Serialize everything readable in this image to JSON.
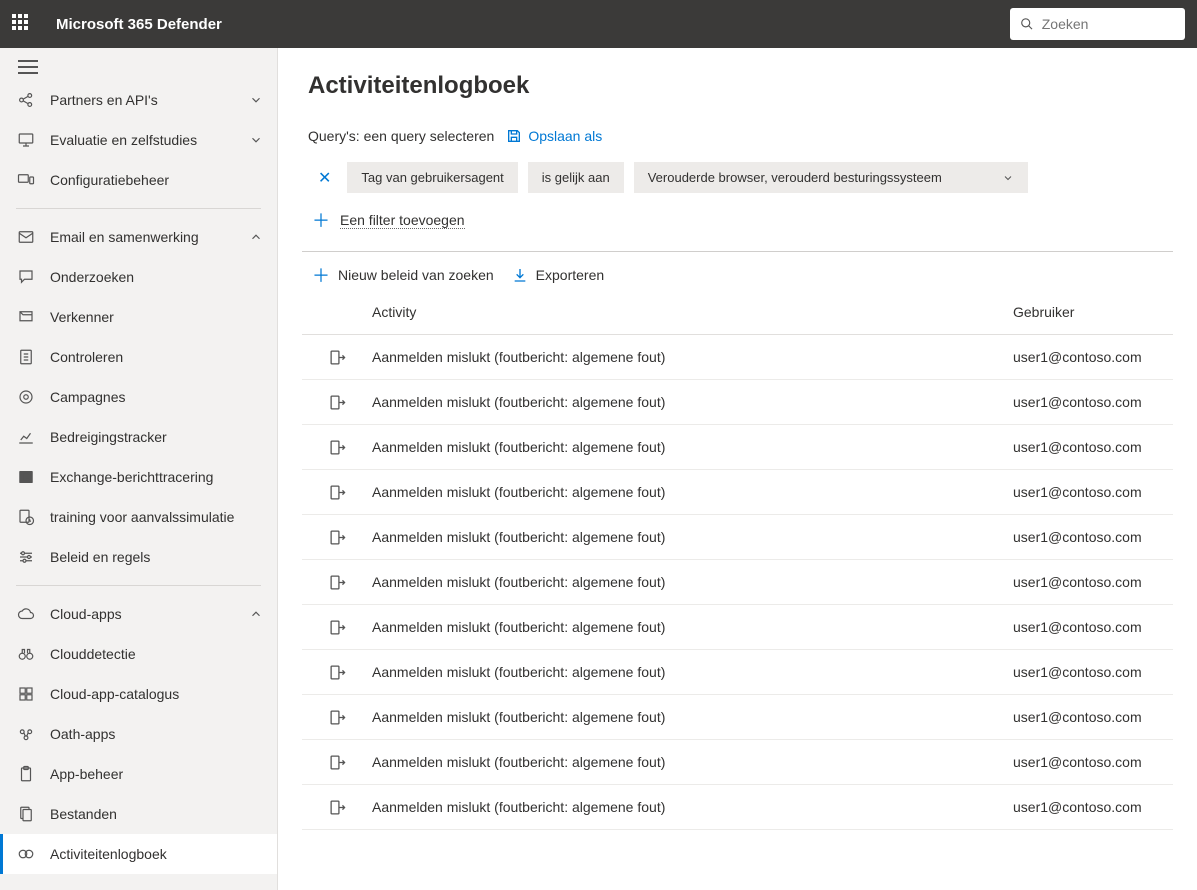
{
  "header": {
    "app_title": "Microsoft 365 Defender",
    "search_placeholder": "Zoeken"
  },
  "sidebar": {
    "groups": [
      {
        "label": "Partners en API's",
        "icon": "share-nodes",
        "chevron": "down"
      },
      {
        "label": "Evaluatie en zelfstudies",
        "icon": "monitor",
        "chevron": "down"
      },
      {
        "label": "Configuratiebeheer",
        "icon": "devices"
      }
    ],
    "email_section": {
      "label": "Email en samenwerking",
      "icon": "mail"
    },
    "email_items": [
      {
        "label": "Onderzoeken",
        "icon": "speech"
      },
      {
        "label": "Verkenner",
        "icon": "explorer"
      },
      {
        "label": "Controleren",
        "icon": "doc-list"
      },
      {
        "label": "Campagnes",
        "icon": "target"
      },
      {
        "label": "Bedreigingstracker",
        "icon": "chart-line"
      },
      {
        "label": "Exchange-berichttracering",
        "icon": "exchange"
      },
      {
        "label": "training voor aanvalssimulatie",
        "icon": "doc-clock"
      },
      {
        "label": "Beleid en regels",
        "icon": "sliders"
      }
    ],
    "cloud_section": {
      "label": "Cloud-apps",
      "icon": "cloud"
    },
    "cloud_items": [
      {
        "label": "Clouddetectie",
        "icon": "binoculars"
      },
      {
        "label": "Cloud-app-catalogus",
        "icon": "grid"
      },
      {
        "label": "Oath-apps",
        "icon": "oath"
      },
      {
        "label": "App-beheer",
        "icon": "clipboard"
      },
      {
        "label": "Bestanden",
        "icon": "files"
      },
      {
        "label": "Activiteitenlogboek",
        "icon": "link-eye",
        "active": true
      }
    ]
  },
  "main": {
    "title": "Activiteitenlogboek",
    "query_label": "Query's: een query selecteren",
    "save_as": "Opslaan als",
    "filters": {
      "tag": "Tag van gebruikersagent",
      "op": "is gelijk aan",
      "value": "Verouderde browser, verouderd besturingssysteem"
    },
    "add_filter": "Een filter toevoegen",
    "actions": {
      "new_policy": "Nieuw beleid van zoeken",
      "export": "Exporteren"
    },
    "columns": {
      "activity": "Activity",
      "user": "Gebruiker"
    },
    "rows": [
      {
        "activity": "Aanmelden mislukt (foutbericht: algemene fout)",
        "user": "user1@contoso.com"
      },
      {
        "activity": "Aanmelden mislukt (foutbericht: algemene fout)",
        "user": "user1@contoso.com"
      },
      {
        "activity": "Aanmelden mislukt (foutbericht: algemene fout)",
        "user": "user1@contoso.com"
      },
      {
        "activity": "Aanmelden mislukt (foutbericht: algemene fout)",
        "user": "user1@contoso.com"
      },
      {
        "activity": "Aanmelden mislukt (foutbericht: algemene fout)",
        "user": "user1@contoso.com"
      },
      {
        "activity": "Aanmelden mislukt (foutbericht: algemene fout)",
        "user": "user1@contoso.com"
      },
      {
        "activity": "Aanmelden mislukt (foutbericht: algemene fout)",
        "user": "user1@contoso.com"
      },
      {
        "activity": "Aanmelden mislukt (foutbericht: algemene fout)",
        "user": "user1@contoso.com"
      },
      {
        "activity": "Aanmelden mislukt (foutbericht: algemene fout)",
        "user": "user1@contoso.com"
      },
      {
        "activity": "Aanmelden mislukt (foutbericht: algemene fout)",
        "user": "user1@contoso.com"
      },
      {
        "activity": "Aanmelden mislukt (foutbericht: algemene fout)",
        "user": "user1@contoso.com"
      }
    ]
  }
}
